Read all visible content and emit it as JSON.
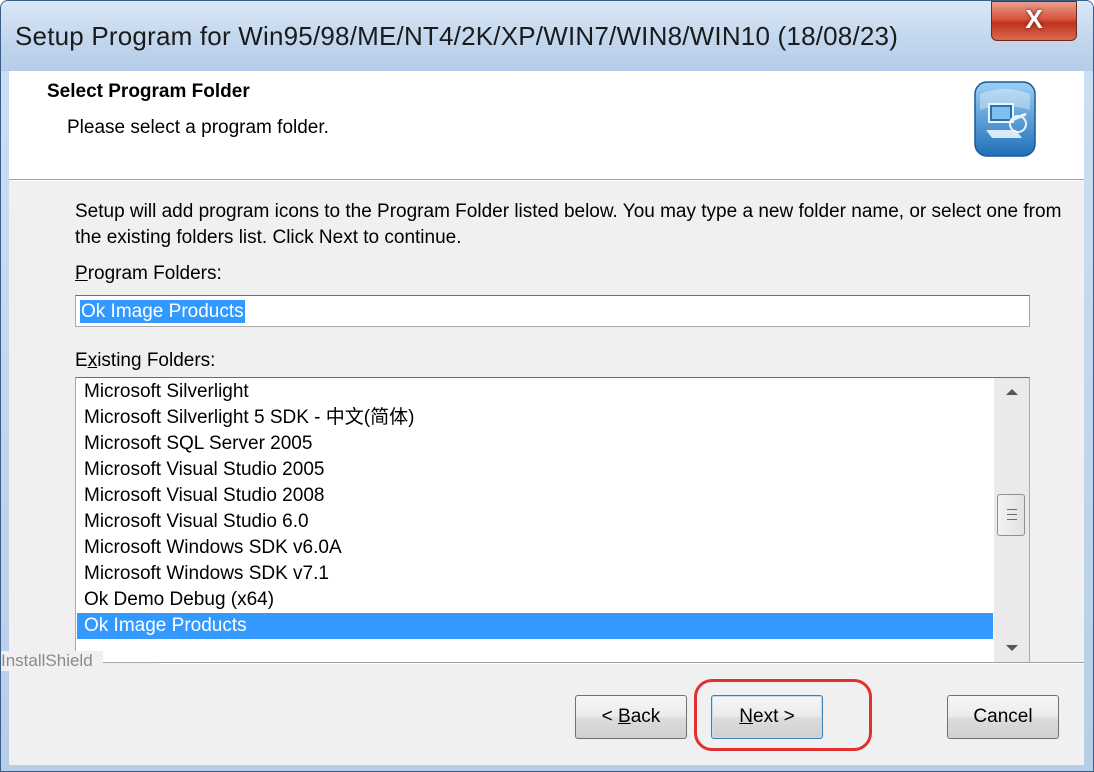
{
  "window": {
    "title": "Setup Program for Win95/98/ME/NT4/2K/XP/WIN7/WIN8/WIN10  (18/08/23)",
    "close_label": "X"
  },
  "header": {
    "title": "Select Program Folder",
    "subtitle": "Please select a program folder.",
    "icon": "installer-computer-icon"
  },
  "body": {
    "description": "Setup will add program icons to the Program Folder listed below.  You may type a new folder name, or select one from the existing folders list.  Click Next to continue.",
    "program_folders_label_mnemonic": "P",
    "program_folders_label_rest": "rogram Folders:",
    "program_folder_value": "Ok Image Products",
    "existing_folders_label_first": "E",
    "existing_folders_label_mnemonic": "x",
    "existing_folders_label_rest": "isting Folders:",
    "existing_folders": [
      "Microsoft Silverlight",
      "Microsoft Silverlight 5 SDK - 中文(简体)",
      "Microsoft SQL Server 2005",
      "Microsoft Visual Studio 2005",
      "Microsoft Visual Studio 2008",
      "Microsoft Visual Studio 6.0",
      "Microsoft Windows SDK v6.0A",
      "Microsoft Windows SDK v7.1",
      "Ok Demo Debug (x64)",
      "Ok Image Products"
    ],
    "selected_folder": "Ok Image Products"
  },
  "footer": {
    "brand": "InstallShield",
    "back_prefix": "< ",
    "back_mnemonic": "B",
    "back_rest": "ack",
    "next_mnemonic": "N",
    "next_rest": "ext >",
    "cancel_label": "Cancel"
  },
  "colors": {
    "selection": "#3399ff",
    "highlight_ring": "#e0302f",
    "titlebar": "#c4d8ee"
  }
}
